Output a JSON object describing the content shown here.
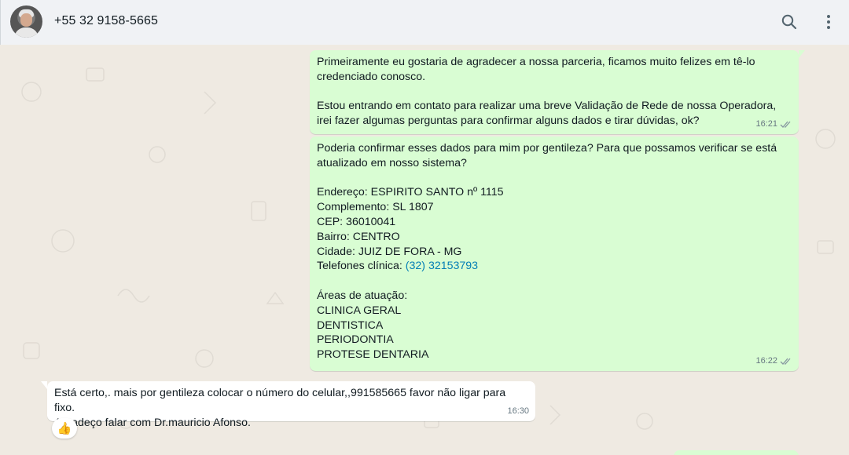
{
  "header": {
    "contact_name": "+55 32 9158-5665",
    "icons": [
      "avatar",
      "search-icon",
      "menu-icon"
    ]
  },
  "messages": [
    {
      "direction": "outgoing",
      "text": "Primeiramente eu gostaria de agradecer a nossa parceria, ficamos muito felizes em tê-lo credenciado conosco.\n\nEstou entrando em contato para realizar uma breve Validação de Rede de nossa Operadora, irei fazer algumas perguntas para confirmar alguns dados e tirar dúvidas, ok?",
      "time": "16:21",
      "status": "read"
    },
    {
      "direction": "outgoing",
      "text_before_link": "Poderia confirmar esses dados para mim por gentileza? Para que possamos verificar se está atualizado em nosso sistema?\n\nEndereço: ESPIRITO SANTO nº 1115\nComplemento: SL 1807\nCEP: 36010041\nBairro: CENTRO\nCidade: JUIZ DE FORA - MG\nTelefones clínica: ",
      "link": "(32) 32153793",
      "text_after_link": "\n\nÁreas de atuação:\nCLINICA GERAL\nDENTISTICA\nPERIODONTIA\nPROTESE DENTARIA",
      "time": "16:22",
      "status": "read"
    },
    {
      "direction": "incoming",
      "text": "Está certo,. mais por gentileza colocar o número do celular,,991585665 favor não ligar para fixo.\nAgradeço falar com Dr.mauricio Afonso.",
      "time": "16:30",
      "reaction": "👍"
    }
  ],
  "colors": {
    "header_bg": "#f0f2f5",
    "chat_bg": "#efeae2",
    "outgoing_bubble": "#d9fdd3",
    "incoming_bubble": "#ffffff",
    "read_ticks": "#8696a0",
    "link": "#027eb5"
  }
}
